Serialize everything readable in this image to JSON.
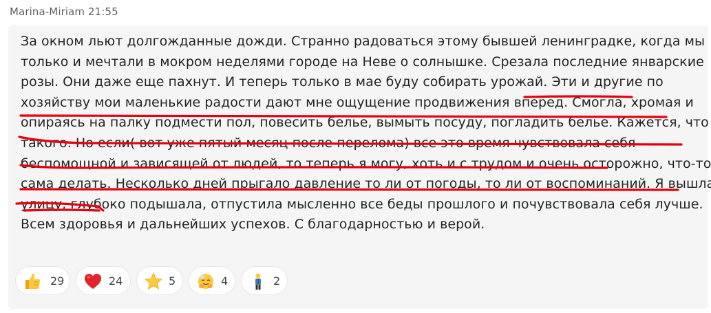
{
  "message": {
    "author": "Marina-Miriam",
    "time": "21:55",
    "lines": [
      "За окном льют долгожданные дожди. Странно радоваться этому  бывшей ленинградке, когда мы",
      "только и мечтали в мокром неделями городе на Неве о солнышке. Срезала последние январские",
      "розы.  Они даже еще пахнут. И теперь только в мае буду собирать урожай. Эти и другие по",
      "хозяйству мои маленькие радости дают мне ощущение продвижения вперед. Смогла, хромая и",
      "опираясь на палку подмести пол, повесить белье, вымыть посуду, погладить белье. Кажется, что тут",
      "такого. Но если( вот уже пятый месяц после перелома) все это время чувствовала себя",
      "беспомощной и зависящей от людей, то теперь я могу, хоть и с трудом и очень осторожно, что-то",
      "сама делать. Несколько дней прыгало давление то ли от погоды, то ли от воспоминаний. Я вышла на",
      "улицу, глубоко подышала, отпустила мысленно все беды прошлого и почувствовала себя лучше.",
      "Всем здоровья и дальнейших успехов. С благодарностью и верой."
    ],
    "highlight_color": "#e3000f"
  },
  "reactions": [
    {
      "emoji": "thumbs-up-icon",
      "count": "29"
    },
    {
      "emoji": "red-heart-icon",
      "count": "24"
    },
    {
      "emoji": "star-icon",
      "count": "5"
    },
    {
      "emoji": "hugging-face-icon",
      "count": "4"
    },
    {
      "emoji": "person-standing-icon",
      "count": "2"
    }
  ]
}
